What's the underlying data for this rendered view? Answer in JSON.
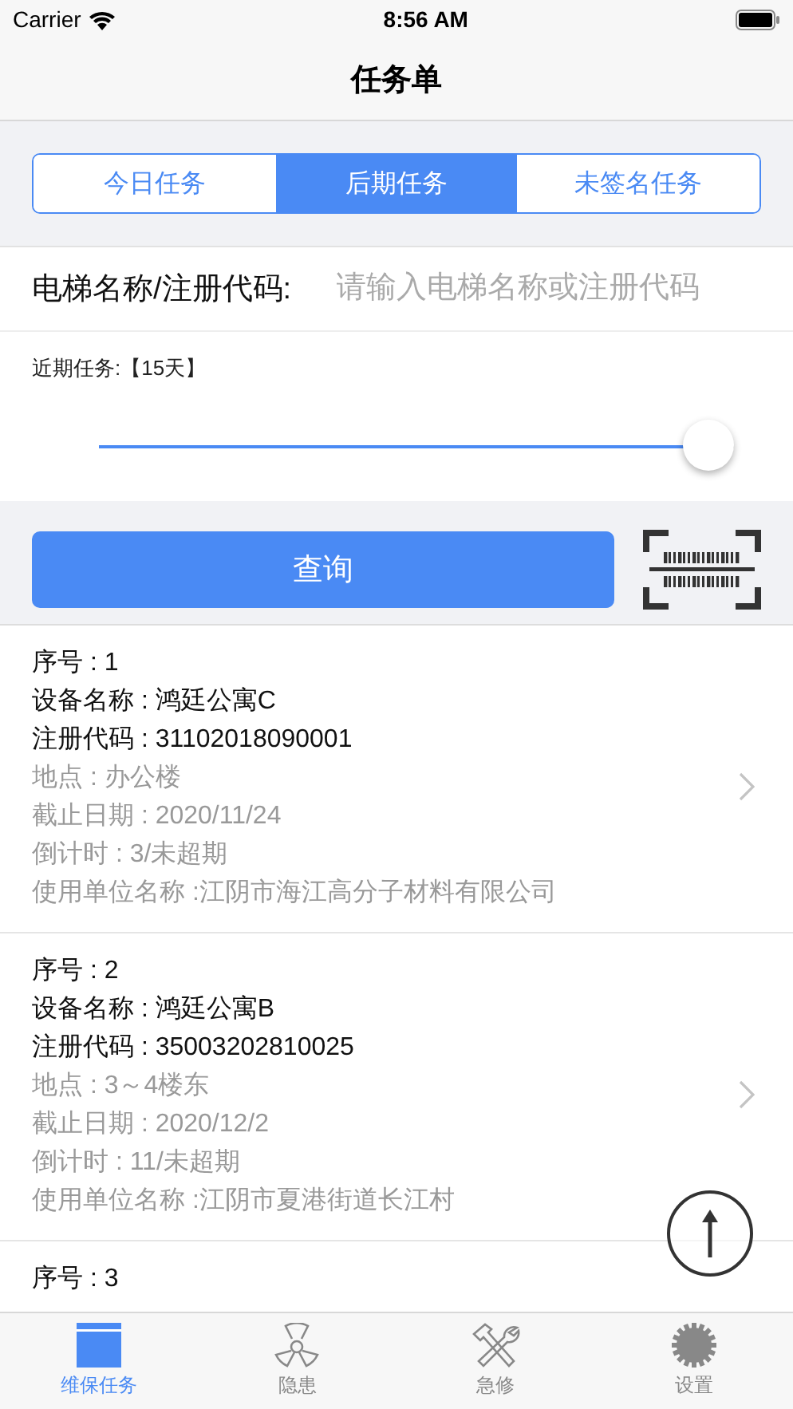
{
  "status_bar": {
    "carrier": "Carrier",
    "time": "8:56 AM"
  },
  "nav": {
    "title": "任务单"
  },
  "segments": [
    {
      "label": "今日任务",
      "selected": false
    },
    {
      "label": "后期任务",
      "selected": true
    },
    {
      "label": "未签名任务",
      "selected": false
    }
  ],
  "search": {
    "label": "电梯名称/注册代码:",
    "placeholder": "请输入电梯名称或注册代码"
  },
  "range": {
    "label": "近期任务:【15天】",
    "level": 0.96
  },
  "query_button": "查询",
  "tasks": [
    {
      "lines": [
        {
          "text": "序号 : 1",
          "kind": "primary"
        },
        {
          "text": "设备名称 : 鸿廷公寓C",
          "kind": "primary"
        },
        {
          "text": "注册代码 : 31102018090001",
          "kind": "primary"
        },
        {
          "text": "地点 : 办公楼",
          "kind": "secondary"
        },
        {
          "text": "截止日期 : 2020/11/24",
          "kind": "secondary"
        },
        {
          "text": "倒计时 : 3/未超期",
          "kind": "secondary"
        },
        {
          "text": "使用单位名称 :江阴市海江高分子材料有限公司",
          "kind": "secondary"
        }
      ]
    },
    {
      "lines": [
        {
          "text": "序号 : 2",
          "kind": "primary"
        },
        {
          "text": "设备名称 : 鸿廷公寓B",
          "kind": "primary"
        },
        {
          "text": "注册代码 : 35003202810025",
          "kind": "primary"
        },
        {
          "text": "地点 : 3～4楼东",
          "kind": "secondary"
        },
        {
          "text": "截止日期 : 2020/12/2",
          "kind": "secondary"
        },
        {
          "text": "倒计时 : 11/未超期",
          "kind": "secondary"
        },
        {
          "text": "使用单位名称 :江阴市夏港街道长江村",
          "kind": "secondary"
        }
      ]
    },
    {
      "lines": [
        {
          "text": "序号 : 3",
          "kind": "primary"
        }
      ]
    }
  ],
  "tab_bar": [
    {
      "label": "维保任务",
      "kind": "calendar",
      "selected": true
    },
    {
      "label": "隐患",
      "kind": "hazard",
      "selected": false
    },
    {
      "label": "急修",
      "kind": "tools",
      "selected": false
    },
    {
      "label": "设置",
      "kind": "gear",
      "selected": false
    }
  ]
}
